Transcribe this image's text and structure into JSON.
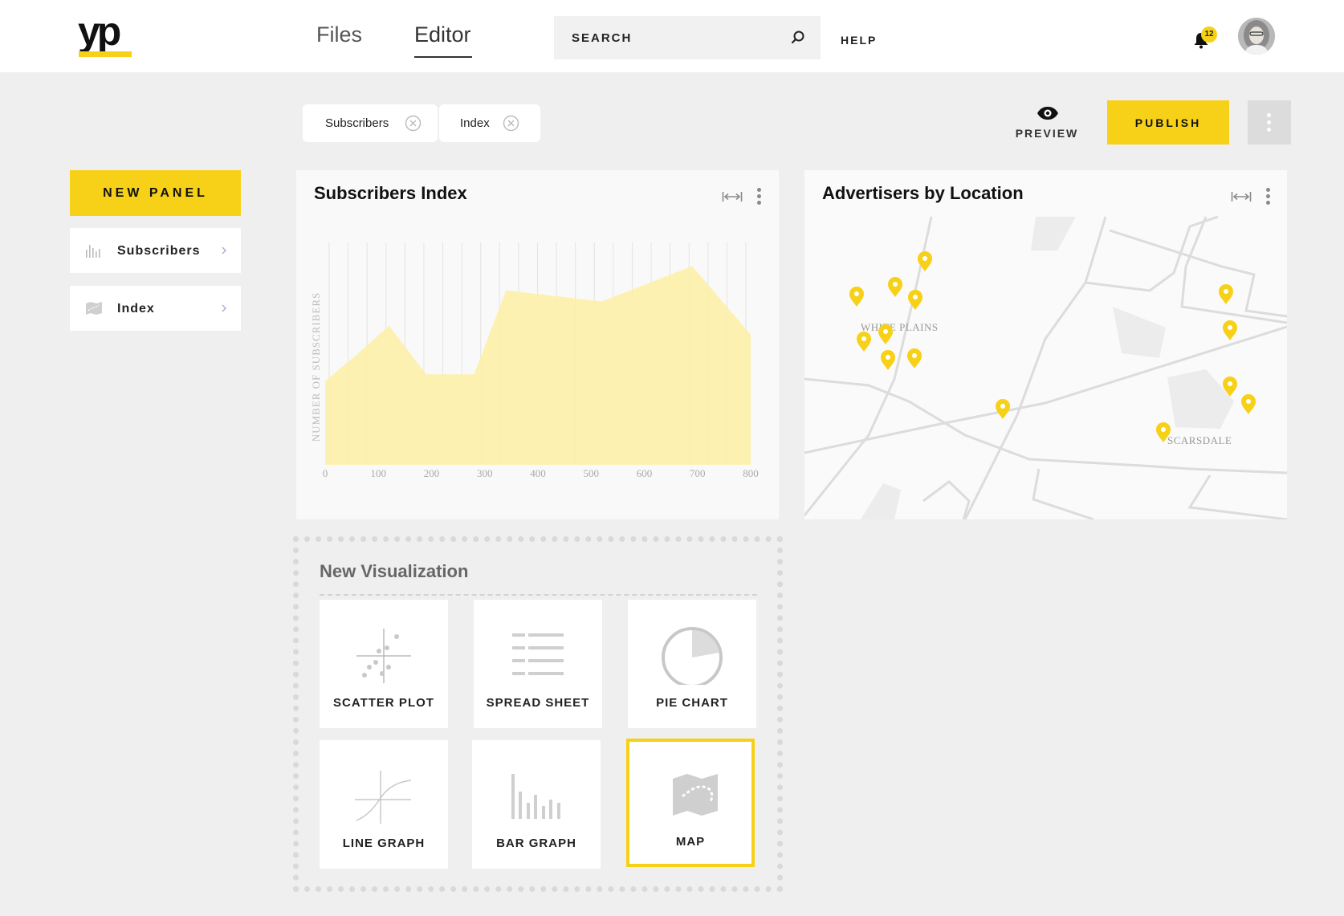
{
  "header": {
    "logo_text": "yp",
    "tabs": [
      {
        "label": "Files",
        "active": false
      },
      {
        "label": "Editor",
        "active": true
      }
    ],
    "search_placeholder": "SEARCH",
    "help_label": "HELP",
    "notification_count": "12"
  },
  "filters": {
    "chips": [
      {
        "label": "Subscribers"
      },
      {
        "label": "Index"
      }
    ]
  },
  "toolbar": {
    "preview_label": "PREVIEW",
    "publish_label": "PUBLISH"
  },
  "sidebar": {
    "new_panel_label": "NEW PANEL",
    "items": [
      {
        "label": "Subscribers",
        "icon": "bar-chart-icon"
      },
      {
        "label": "Index",
        "icon": "map-icon"
      }
    ]
  },
  "panels": {
    "subscribers": {
      "title": "Subscribers Index"
    },
    "advertisers": {
      "title": "Advertisers by Location"
    }
  },
  "chart_data": {
    "type": "area",
    "title": "Subscribers Index",
    "xlabel": "",
    "ylabel": "NUMBER OF SUBSCRIBERS",
    "x_ticks": [
      0,
      100,
      200,
      300,
      400,
      500,
      600,
      700,
      800
    ],
    "xlim": [
      0,
      800
    ],
    "ylim": [
      0,
      100
    ],
    "x": [
      0,
      60,
      120,
      190,
      280,
      340,
      520,
      690,
      800
    ],
    "values": [
      38,
      50,
      63,
      41,
      41,
      79,
      74,
      90,
      59
    ],
    "grid": "vertical",
    "color": "#fdf0a8"
  },
  "map": {
    "city_labels": [
      "WHITE PLAINS",
      "SCARSDALE"
    ],
    "pin_color": "#f7d117",
    "pin_count": 15
  },
  "new_visualization": {
    "title": "New Visualization",
    "tiles": [
      {
        "label": "SCATTER PLOT",
        "icon": "scatter-plot-icon",
        "selected": false
      },
      {
        "label": "SPREAD SHEET",
        "icon": "spreadsheet-icon",
        "selected": false
      },
      {
        "label": "PIE CHART",
        "icon": "pie-chart-icon",
        "selected": false
      },
      {
        "label": "LINE GRAPH",
        "icon": "line-graph-icon",
        "selected": false
      },
      {
        "label": "BAR GRAPH",
        "icon": "bar-graph-icon",
        "selected": false
      },
      {
        "label": "MAP",
        "icon": "map-icon",
        "selected": true
      }
    ]
  },
  "colors": {
    "accent": "#f7d117",
    "background": "#efefef"
  }
}
